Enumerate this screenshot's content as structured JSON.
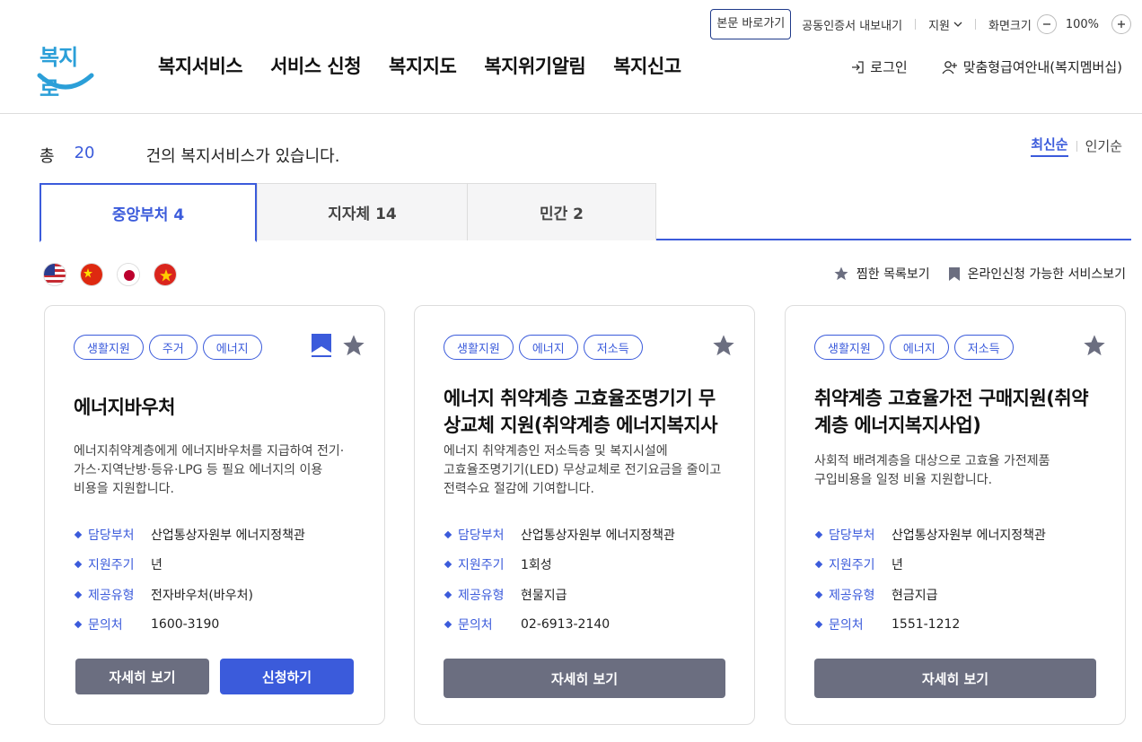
{
  "utility": {
    "skip_link": "본문 바로가기",
    "cert_export": "공동인증서 내보내기",
    "lang": "지원",
    "zoom_label": "화면크기",
    "zoom_value": "100%"
  },
  "logo": {
    "text": "복지로"
  },
  "gnb": [
    "복지서비스",
    "서비스 신청",
    "복지지도",
    "복지위기알림",
    "복지신고"
  ],
  "auth": {
    "login": "로그인",
    "membership": "맞춤형급여안내(복지멤버십)"
  },
  "summary": {
    "prefix": "총",
    "count": "20",
    "suffix": "건의 복지서비스가 있습니다."
  },
  "sort": {
    "latest": "최신순",
    "popular": "인기순"
  },
  "tabs": [
    {
      "label": "중앙부처 4"
    },
    {
      "label": "지자체 14"
    },
    {
      "label": "민간 2"
    }
  ],
  "flags": [
    "us-flag",
    "cn-flag",
    "jp-flag",
    "vn-flag"
  ],
  "toggles": {
    "favorites": "찜한 목록보기",
    "online": "온라인신청 가능한 서비스보기"
  },
  "cards": [
    {
      "tags": [
        "생활지원",
        "주거",
        "에너지"
      ],
      "title": "에너지바우처",
      "desc": "에너지취약계층에게 에너지바우처를 지급하여 전기·가스·지역난방·등유·LPG 등 필요 에너지의 이용 비용을 지원합니다.",
      "info": [
        {
          "k": "담당부처",
          "v": "산업통상자원부 에너지정책관"
        },
        {
          "k": "지원주기",
          "v": "년"
        },
        {
          "k": "제공유형",
          "v": "전자바우처(바우처)"
        },
        {
          "k": "문의처",
          "v": "1600-3190"
        }
      ],
      "detail": "자세히 보기",
      "apply": "신청하기"
    },
    {
      "tags": [
        "생활지원",
        "에너지",
        "저소득"
      ],
      "title": "에너지 취약계층 고효율조명기기 무상교체 지원(취약계층 에너지복지사",
      "desc": "에너지 취약계층인 저소득층 및 복지시설에 고효율조명기기(LED) 무상교체로 전기요금을 줄이고 전력수요 절감에 기여합니다.",
      "info": [
        {
          "k": "담당부처",
          "v": "산업통상자원부 에너지정책관"
        },
        {
          "k": "지원주기",
          "v": "1회성"
        },
        {
          "k": "제공유형",
          "v": "현물지급"
        },
        {
          "k": "문의처",
          "v": "02-6913-2140"
        }
      ],
      "detail": "자세히 보기"
    },
    {
      "tags": [
        "생활지원",
        "에너지",
        "저소득"
      ],
      "title": "취약계층 고효율가전 구매지원(취약계층 에너지복지사업)",
      "desc": "사회적 배려계층을 대상으로 고효율 가전제품 구입비용을 일정 비율 지원합니다.",
      "info": [
        {
          "k": "담당부처",
          "v": "산업통상자원부 에너지정책관"
        },
        {
          "k": "지원주기",
          "v": "년"
        },
        {
          "k": "제공유형",
          "v": "현금지급"
        },
        {
          "k": "문의처",
          "v": "1551-1212"
        }
      ],
      "detail": "자세히 보기"
    }
  ],
  "colors": {
    "accent": "#3b5bdb",
    "button_gray": "#6b6e80",
    "logo": "#2b9fd8"
  }
}
